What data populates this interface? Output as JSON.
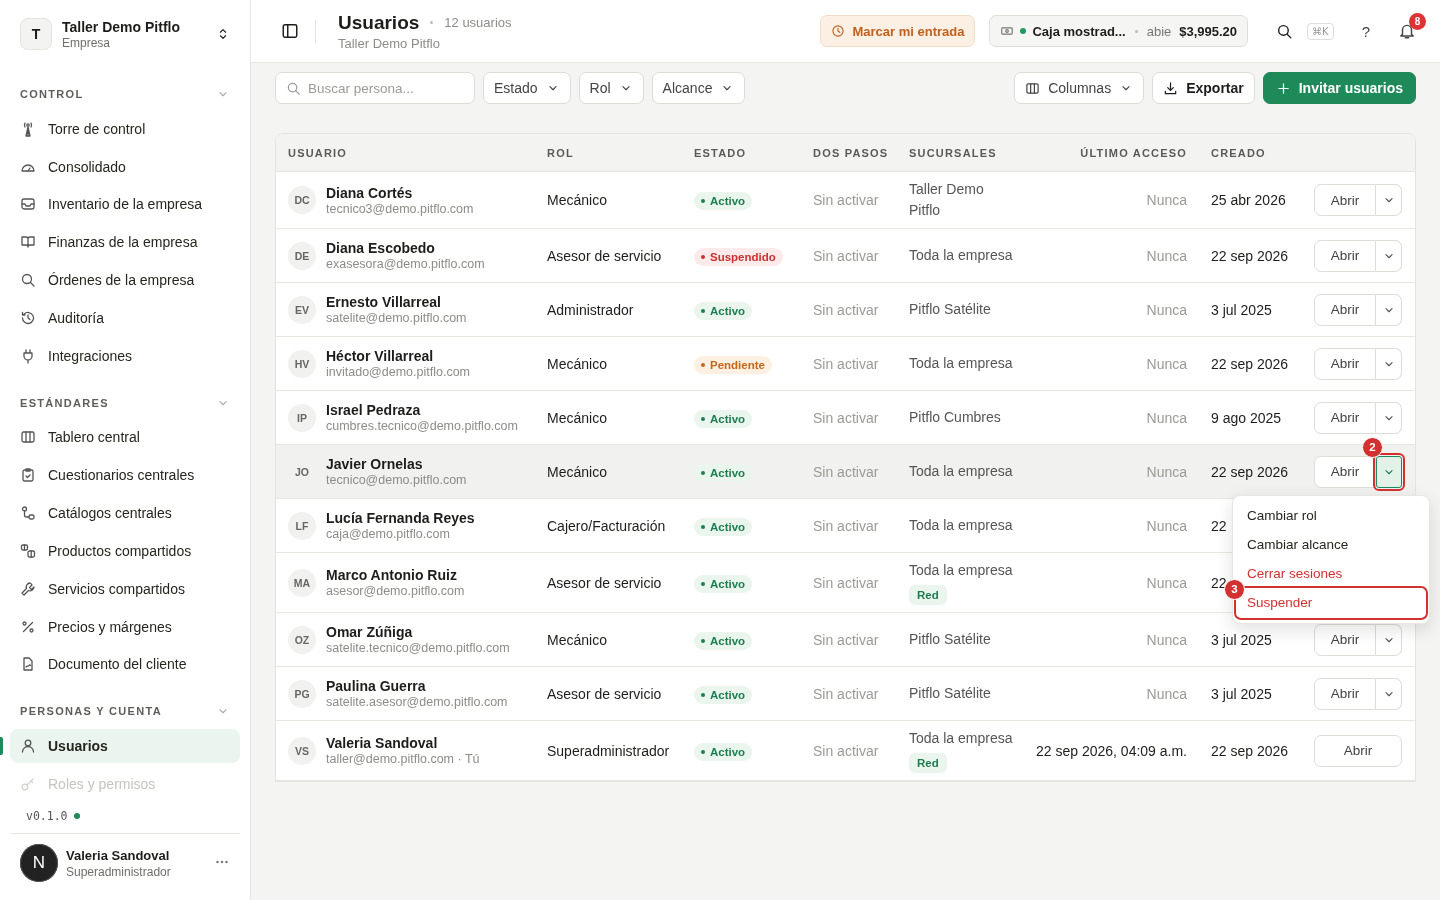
{
  "sidebar": {
    "workspace": {
      "initial": "T",
      "name": "Taller Demo Pitflo",
      "subtitle": "Empresa"
    },
    "sections": [
      {
        "title": "CONTROL",
        "expanded": true,
        "items": [
          {
            "label": "Torre de control",
            "selected": false,
            "disabled": false
          },
          {
            "label": "Consolidado",
            "selected": false,
            "disabled": false
          },
          {
            "label": "Inventario de la empresa",
            "selected": false,
            "disabled": false
          },
          {
            "label": "Finanzas de la empresa",
            "selected": false,
            "disabled": false
          },
          {
            "label": "Órdenes de la empresa",
            "selected": false,
            "disabled": false
          },
          {
            "label": "Auditoría",
            "selected": false,
            "disabled": false
          },
          {
            "label": "Integraciones",
            "selected": false,
            "disabled": false
          }
        ]
      },
      {
        "title": "ESTÁNDARES",
        "expanded": true,
        "items": [
          {
            "label": "Tablero central",
            "selected": false,
            "disabled": false
          },
          {
            "label": "Cuestionarios centrales",
            "selected": false,
            "disabled": false
          },
          {
            "label": "Catálogos centrales",
            "selected": false,
            "disabled": false
          },
          {
            "label": "Productos compartidos",
            "selected": false,
            "disabled": false
          },
          {
            "label": "Servicios compartidos",
            "selected": false,
            "disabled": false
          },
          {
            "label": "Precios y márgenes",
            "selected": false,
            "disabled": false
          },
          {
            "label": "Documento del cliente",
            "selected": false,
            "disabled": false
          }
        ]
      },
      {
        "title": "PERSONAS Y CUENTA",
        "expanded": true,
        "items": [
          {
            "label": "Usuarios",
            "selected": true,
            "disabled": false
          },
          {
            "label": "Roles y permisos",
            "selected": false,
            "disabled": true
          }
        ]
      }
    ],
    "version": "v0.1.0",
    "user": {
      "initial": "N",
      "name": "Valeria Sandoval",
      "role": "Superadministrador"
    }
  },
  "header": {
    "title": "Usuarios",
    "count": "12 usuarios",
    "subtitle": "Taller Demo Pitflo",
    "clock_in": "Marcar mi entrada",
    "register": {
      "name": "Caja mostrad...",
      "status": "abie",
      "amount": "$3,995.20"
    },
    "shortcut": "⌘K",
    "help": "?",
    "notifications": "8"
  },
  "toolbar": {
    "search": {
      "placeholder": "Buscar persona..."
    },
    "filters": [
      "Estado",
      "Rol",
      "Alcance"
    ],
    "columns": "Columnas",
    "export": "Exportar",
    "invite": "Invitar usuarios"
  },
  "table": {
    "columns": [
      "USUARIO",
      "ROL",
      "ESTADO",
      "DOS PASOS",
      "SUCURSALES",
      "ÚLTIMO ACCESO",
      "CREADO"
    ],
    "rows": [
      {
        "initials": "DC",
        "name": "Diana Cortés",
        "email": "tecnico3@demo.pitflo.com",
        "role": "Mecánico",
        "status": {
          "label": "Activo",
          "kind": "active"
        },
        "two_step": "Sin activar",
        "branches": "Taller Demo Pitflo",
        "last_access": "Nunca",
        "last_access_muted": true,
        "created": "25 abr 2026",
        "highlighted": false,
        "actions": {
          "label": "Abrir",
          "has_menu": true
        }
      },
      {
        "initials": "DE",
        "name": "Diana Escobedo",
        "email": "exasesora@demo.pitflo.com",
        "role": "Asesor de servicio",
        "status": {
          "label": "Suspendido",
          "kind": "suspended"
        },
        "two_step": "Sin activar",
        "branches": "Toda la empresa",
        "last_access": "Nunca",
        "last_access_muted": true,
        "created": "22 sep 2026",
        "highlighted": false,
        "actions": {
          "label": "Abrir",
          "has_menu": true
        }
      },
      {
        "initials": "EV",
        "name": "Ernesto Villarreal",
        "email": "satelite@demo.pitflo.com",
        "role": "Administrador",
        "status": {
          "label": "Activo",
          "kind": "active"
        },
        "two_step": "Sin activar",
        "branches": "Pitflo Satélite",
        "last_access": "Nunca",
        "last_access_muted": true,
        "created": "3 jul 2025",
        "highlighted": false,
        "actions": {
          "label": "Abrir",
          "has_menu": true
        }
      },
      {
        "initials": "HV",
        "name": "Héctor Villarreal",
        "email": "invitado@demo.pitflo.com",
        "role": "Mecánico",
        "status": {
          "label": "Pendiente",
          "kind": "pending"
        },
        "two_step": "Sin activar",
        "branches": "Toda la empresa",
        "last_access": "Nunca",
        "last_access_muted": true,
        "created": "22 sep 2026",
        "highlighted": false,
        "actions": {
          "label": "Abrir",
          "has_menu": true
        }
      },
      {
        "initials": "IP",
        "name": "Israel Pedraza",
        "email": "cumbres.tecnico@demo.pitflo.com",
        "role": "Mecánico",
        "status": {
          "label": "Activo",
          "kind": "active"
        },
        "two_step": "Sin activar",
        "branches": "Pitflo Cumbres",
        "last_access": "Nunca",
        "last_access_muted": true,
        "created": "9 ago 2025",
        "highlighted": false,
        "actions": {
          "label": "Abrir",
          "has_menu": true
        }
      },
      {
        "initials": "JO",
        "name": "Javier Ornelas",
        "email": "tecnico@demo.pitflo.com",
        "role": "Mecánico",
        "status": {
          "label": "Activo",
          "kind": "active"
        },
        "two_step": "Sin activar",
        "branches": "Toda la empresa",
        "last_access": "Nunca",
        "last_access_muted": true,
        "created": "22 sep 2026",
        "highlighted": true,
        "actions": {
          "label": "Abrir",
          "has_menu": true,
          "menu_open": true,
          "annotation": "2"
        }
      },
      {
        "initials": "LF",
        "name": "Lucía Fernanda Reyes",
        "email": "caja@demo.pitflo.com",
        "role": "Cajero/Facturación",
        "status": {
          "label": "Activo",
          "kind": "active"
        },
        "two_step": "Sin activar",
        "branches": "Toda la empresa",
        "last_access": "Nunca",
        "last_access_muted": true,
        "created": "22",
        "highlighted": false
      },
      {
        "initials": "MA",
        "name": "Marco Antonio Ruiz",
        "email": "asesor@demo.pitflo.com",
        "role": "Asesor de servicio",
        "status": {
          "label": "Activo",
          "kind": "active"
        },
        "two_step": "Sin activar",
        "branches": "Toda la empresa",
        "tag": "Red",
        "last_access": "Nunca",
        "last_access_muted": true,
        "created": "22",
        "highlighted": false
      },
      {
        "initials": "OZ",
        "name": "Omar Zúñiga",
        "email": "satelite.tecnico@demo.pitflo.com",
        "role": "Mecánico",
        "status": {
          "label": "Activo",
          "kind": "active"
        },
        "two_step": "Sin activar",
        "branches": "Pitflo Satélite",
        "last_access": "Nunca",
        "last_access_muted": true,
        "created": "3 jul 2025",
        "highlighted": false,
        "actions": {
          "label": "Abrir",
          "has_menu": true
        }
      },
      {
        "initials": "PG",
        "name": "Paulina Guerra",
        "email": "satelite.asesor@demo.pitflo.com",
        "role": "Asesor de servicio",
        "status": {
          "label": "Activo",
          "kind": "active"
        },
        "two_step": "Sin activar",
        "branches": "Pitflo Satélite",
        "last_access": "Nunca",
        "last_access_muted": true,
        "created": "3 jul 2025",
        "highlighted": false,
        "actions": {
          "label": "Abrir",
          "has_menu": true
        }
      },
      {
        "initials": "VS",
        "name": "Valeria Sandoval",
        "email": "taller@demo.pitflo.com · Tú",
        "role": "Superadministrador",
        "status": {
          "label": "Activo",
          "kind": "active"
        },
        "two_step": "Sin activar",
        "branches": "Toda la empresa",
        "tag": "Red",
        "last_access": "22 sep 2026, 04:09 a.m.",
        "last_access_muted": false,
        "created": "22 sep 2026",
        "highlighted": false,
        "actions": {
          "label": "Abrir",
          "has_menu": false
        }
      }
    ]
  },
  "row_menu": {
    "items": [
      {
        "label": "Cambiar rol",
        "kind": "normal"
      },
      {
        "label": "Cambiar alcance",
        "kind": "normal"
      },
      {
        "label": "Cerrar sesiones",
        "kind": "danger"
      },
      {
        "label": "Suspender",
        "kind": "danger",
        "annotation": "3"
      }
    ]
  }
}
